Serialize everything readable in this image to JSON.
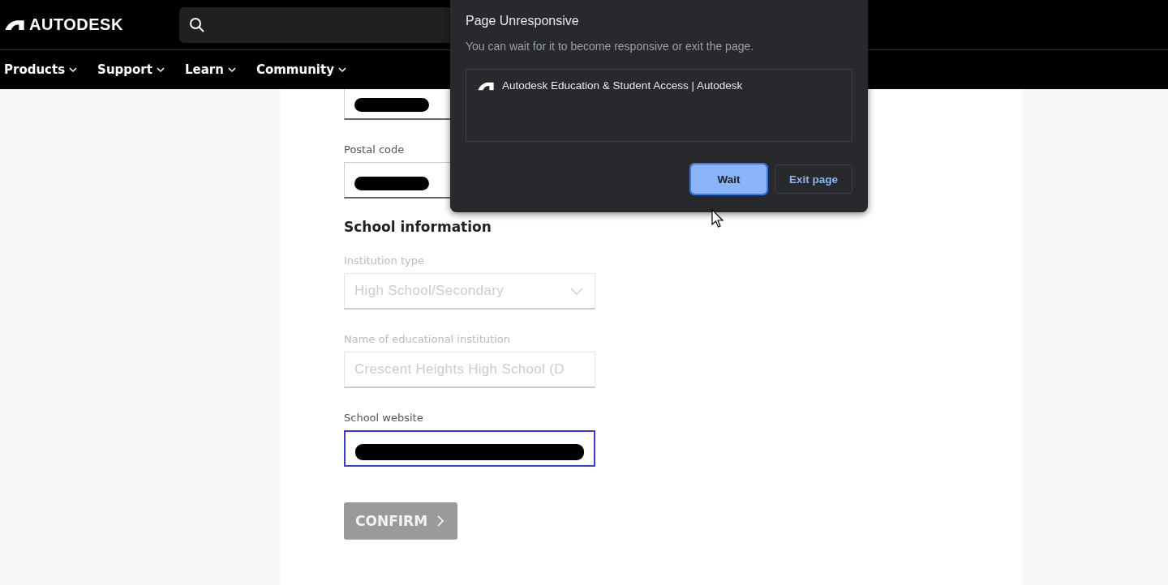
{
  "header": {
    "logo": "AUTODESK"
  },
  "nav": [
    {
      "label": "Products"
    },
    {
      "label": "Support"
    },
    {
      "label": "Learn"
    },
    {
      "label": "Community"
    }
  ],
  "form": {
    "fields_top": [
      {
        "redacted": true,
        "disabled": false,
        "focused": false
      },
      {
        "label": "Postal code",
        "redacted": true,
        "disabled": false,
        "focused": false
      }
    ],
    "section_title": "School information",
    "fields": [
      {
        "label": "Institution type",
        "kind": "select",
        "value": "High School/Secondary",
        "redacted": false,
        "disabled": true,
        "focused": false
      },
      {
        "label": "Name of educational institution",
        "kind": "text",
        "value": "Crescent Heights High School (D",
        "redacted": false,
        "disabled": true,
        "focused": false
      },
      {
        "label": "School website",
        "kind": "text",
        "redacted": true,
        "disabled": false,
        "focused": true
      }
    ],
    "submit": {
      "label": "CONFIRM",
      "disabled": true
    }
  },
  "dialog": {
    "title": "Page Unresponsive",
    "message": "You can wait for it to become responsive or exit the page.",
    "pages": [
      "Autodesk Education & Student Access | Autodesk"
    ],
    "buttons": [
      {
        "label": "Wait",
        "kind": "primary",
        "focused": true
      },
      {
        "label": "Exit page",
        "kind": "secondary",
        "focused": false
      }
    ]
  }
}
